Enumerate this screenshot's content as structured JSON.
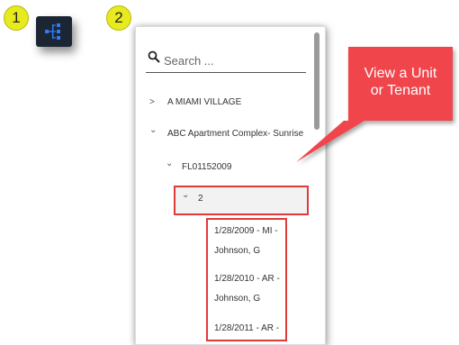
{
  "steps": {
    "step1": "1",
    "step2": "2"
  },
  "icons": {
    "tree_button": "org-tree-icon",
    "search": "search-icon",
    "collapsed": "chevron-right-icon",
    "expanded": "chevron-down-icon"
  },
  "colors": {
    "badge": "#e8ea20",
    "tree_button_bg": "#1c2633",
    "tree_icon": "#2e7cf6",
    "highlight": "#e03a3a",
    "callout": "#f0454b"
  },
  "search": {
    "placeholder": "Search ..."
  },
  "tree": {
    "property1": {
      "label": "A MIAMI VILLAGE",
      "chevron": ">"
    },
    "property2": {
      "label": "ABC Apartment Complex- Sunrise",
      "chevron": "⌄"
    },
    "building": {
      "label": "FL01152009",
      "chevron": "⌄"
    },
    "unit": {
      "label": "2",
      "chevron": "⌄"
    },
    "tenants": [
      {
        "line1": "1/28/2009 - MI -",
        "line2": "Johnson, G"
      },
      {
        "line1": "1/28/2010 - AR -",
        "line2": "Johnson, G"
      },
      {
        "line1": "1/28/2011 - AR -",
        "line2": ""
      }
    ]
  },
  "callout": {
    "line1": "View a Unit",
    "line2": "or Tenant"
  }
}
